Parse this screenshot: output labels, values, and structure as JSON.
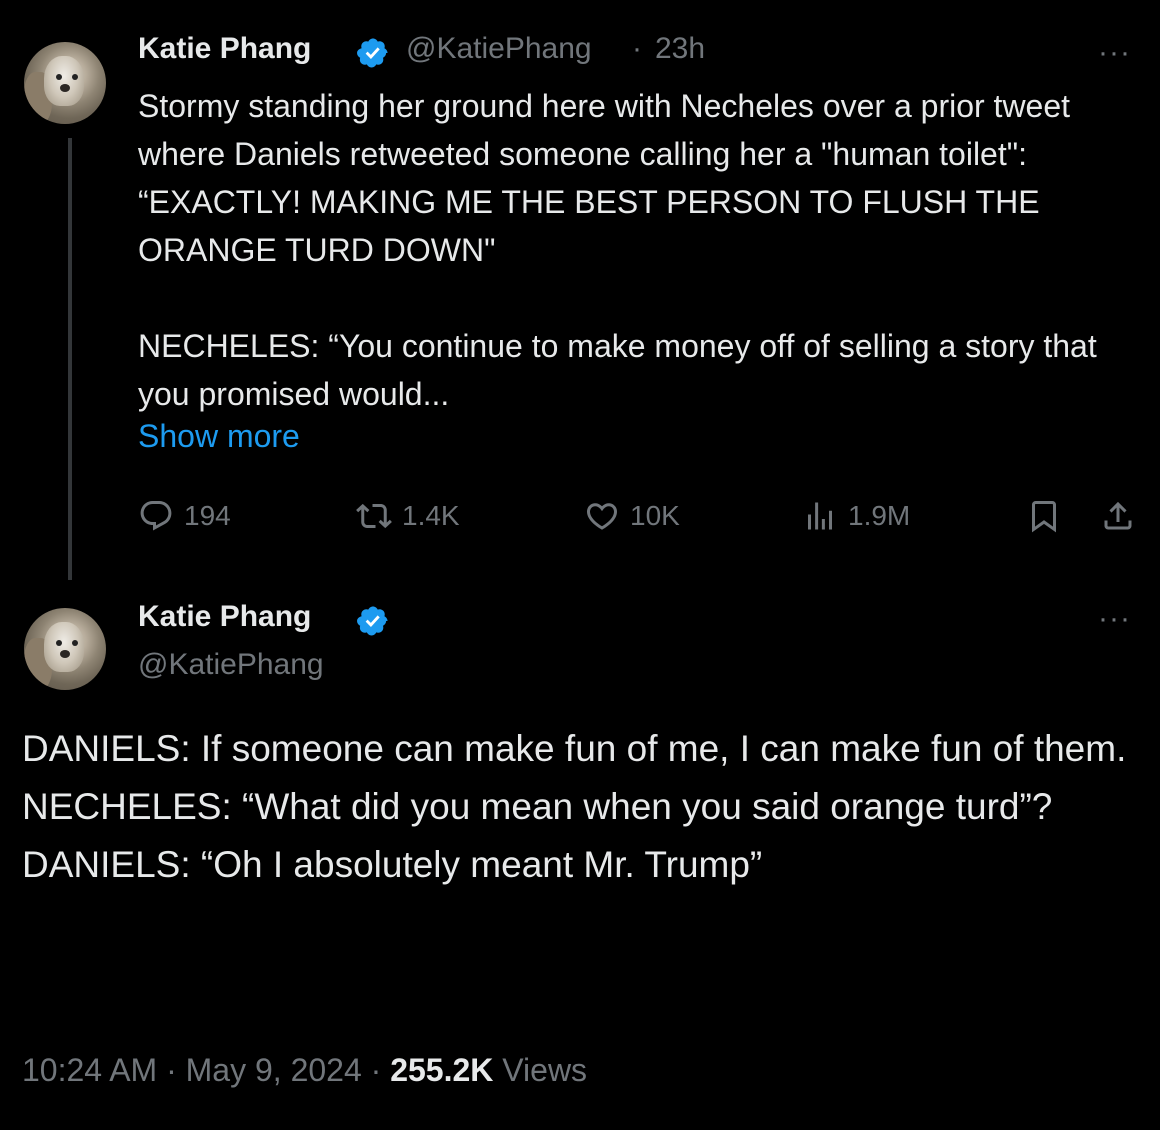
{
  "tweet1": {
    "author_name": "Katie Phang",
    "handle": "@KatiePhang",
    "time": "23h",
    "paragraphs": [
      "Stormy standing her ground here with Necheles over a prior tweet where Daniels retweeted someone calling her a \"human toilet\": “EXACTLY! MAKING ME THE BEST PERSON TO FLUSH THE ORANGE TURD DOWN\"",
      "NECHELES: “You continue to make money off of selling a story that you promised would..."
    ],
    "show_more": "Show more",
    "replies": "194",
    "reposts": "1.4K",
    "likes": "10K",
    "views": "1.9M",
    "more_label": "···"
  },
  "tweet2": {
    "author_name": "Katie Phang",
    "handle": "@KatiePhang",
    "lines": [
      "DANIELS: If someone can make fun of me, I can make fun of them.",
      "NECHELES: “What did you mean when you said orange turd”?",
      "DANIELS: “Oh I absolutely meant Mr. Trump”"
    ],
    "timestamp": "10:24 AM · May 9, 2024 · ",
    "views_count": "255.2K",
    "views_label": " Views",
    "more_label": "···"
  },
  "colors": {
    "background": "#000000",
    "text": "#e7e9ea",
    "secondary": "#71767b",
    "link": "#1d9bf0",
    "verified": "#1d9bf0"
  },
  "icons": [
    "avatar",
    "verified-badge-icon",
    "more-icon",
    "reply-icon",
    "repost-icon",
    "like-icon",
    "views-icon",
    "bookmark-icon",
    "share-icon"
  ]
}
